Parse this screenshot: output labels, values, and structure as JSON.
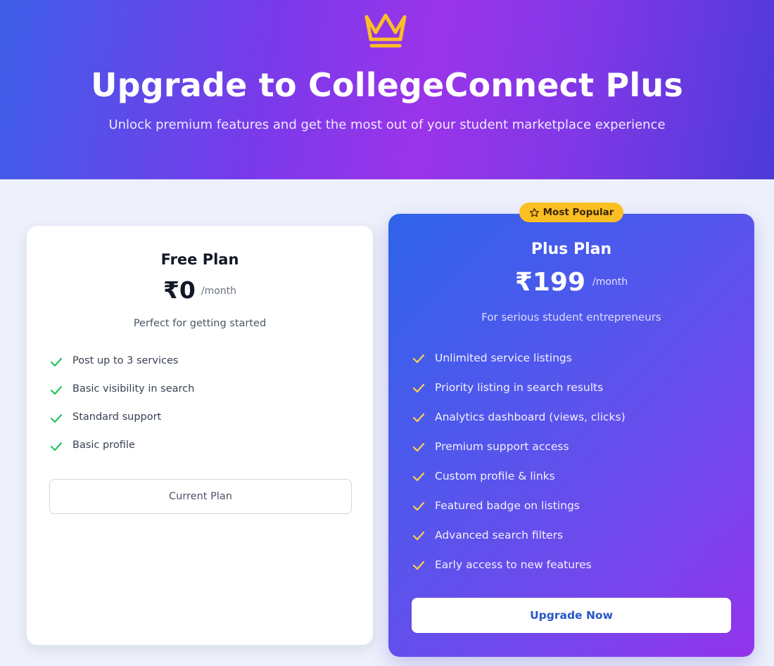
{
  "hero": {
    "title": "Upgrade to CollegeConnect Plus",
    "subtitle": "Unlock premium features and get the most out of your student marketplace experience",
    "icon": "crown-icon"
  },
  "colors": {
    "accent_gold": "#fbbf24",
    "check_green": "#22c55e",
    "plus_gradient_start": "#2f64ea",
    "plus_gradient_end": "#9333ea",
    "upgrade_text": "#2756c8"
  },
  "free_plan": {
    "name": "Free Plan",
    "price": "₹0",
    "period": "/month",
    "tagline": "Perfect for getting started",
    "features": [
      "Post up to 3 services",
      "Basic visibility in search",
      "Standard support",
      "Basic profile"
    ],
    "button_label": "Current Plan"
  },
  "plus_plan": {
    "badge": "Most Popular",
    "badge_icon": "star-icon",
    "name": "Plus Plan",
    "price": "₹199",
    "period": "/month",
    "tagline": "For serious student entrepreneurs",
    "features": [
      "Unlimited service listings",
      "Priority listing in search results",
      "Analytics dashboard (views, clicks)",
      "Premium support access",
      "Custom profile & links",
      "Featured badge on listings",
      "Advanced search filters",
      "Early access to new features"
    ],
    "button_label": "Upgrade Now"
  }
}
